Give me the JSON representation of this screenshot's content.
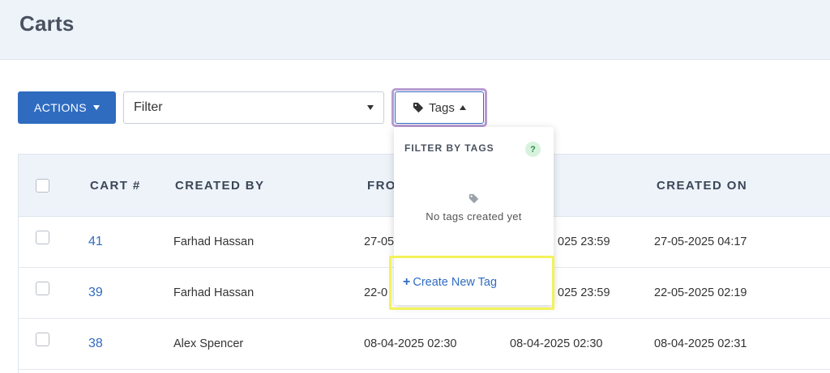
{
  "header": {
    "title": "Carts"
  },
  "toolbar": {
    "actions_label": "ACTIONS",
    "filter_value": "Filter",
    "tags_label": "Tags"
  },
  "table": {
    "columns": [
      "CART #",
      "CREATED BY",
      "FRO",
      "CREATED ON"
    ],
    "rows": [
      {
        "cart": "41",
        "created_by": "Farhad Hassan",
        "from": "27-05",
        "to": "025 23:59",
        "created_on": "27-05-2025 04:17"
      },
      {
        "cart": "39",
        "created_by": "Farhad Hassan",
        "from": "22-0",
        "to": "025 23:59",
        "created_on": "22-05-2025 02:19"
      },
      {
        "cart": "38",
        "created_by": "Alex Spencer",
        "from": "08-04-2025 02:30",
        "to": "08-04-2025 02:30",
        "created_on": "08-04-2025 02:31"
      }
    ]
  },
  "tags_dropdown": {
    "title": "FILTER BY TAGS",
    "help": "?",
    "empty_text": "No tags created yet",
    "create_label": "Create New Tag",
    "create_prefix": "+"
  },
  "colors": {
    "accent": "#2f6cc0",
    "header_bg": "#eef3fa",
    "highlight_yellow": "#f3f25a",
    "focus_purple": "#b79bd1"
  }
}
